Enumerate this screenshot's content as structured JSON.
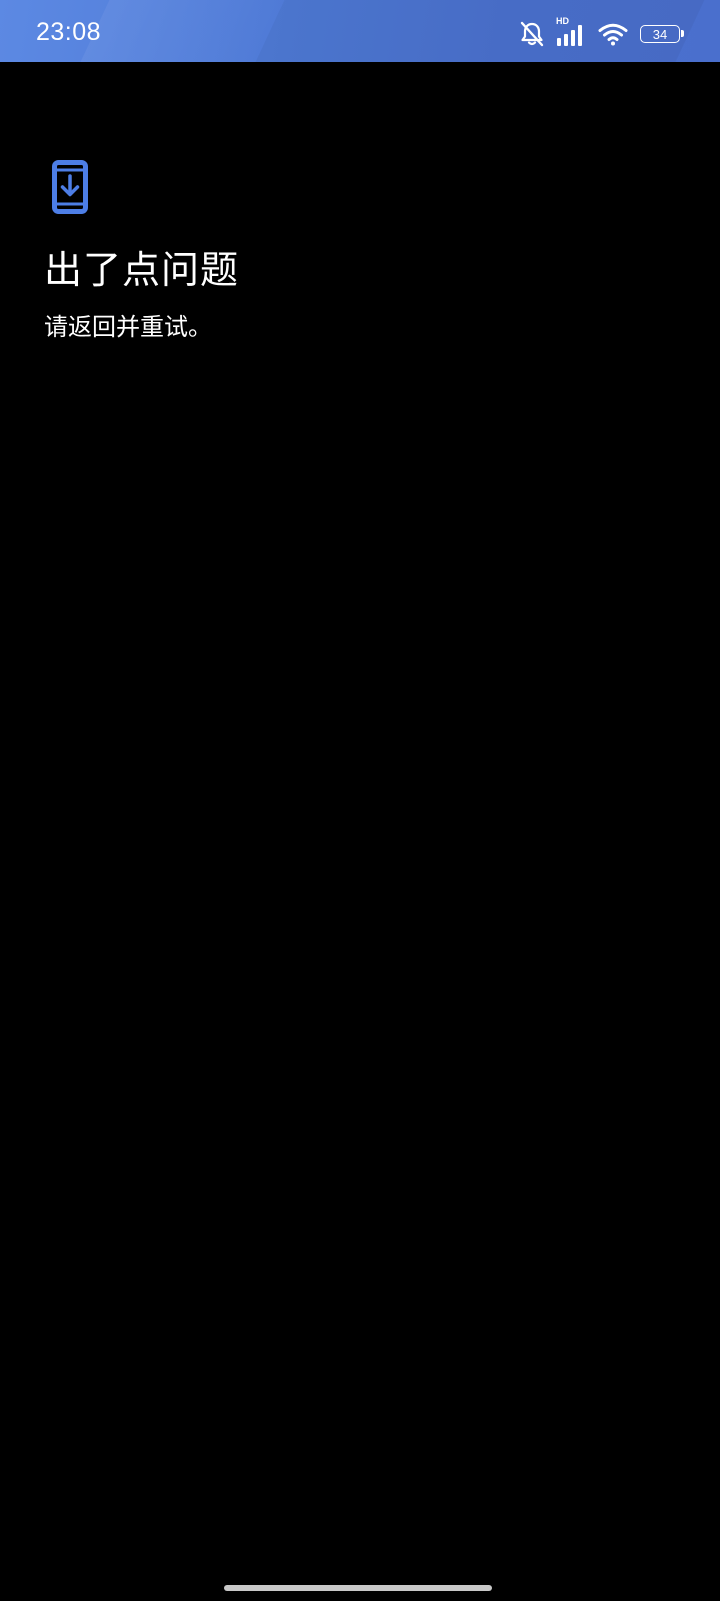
{
  "status_bar": {
    "time": "23:08",
    "battery_level": "34",
    "network_label": "HD",
    "icons": [
      "mute-bell-icon",
      "signal-icon",
      "wifi-icon",
      "battery-icon"
    ],
    "background_color": "#5580d9"
  },
  "error": {
    "icon": "phone-download-icon",
    "icon_color": "#4d7ee6",
    "title": "出了点问题",
    "message": "请返回并重试。"
  },
  "navigation": {
    "home_indicator_color": "#c8c8c8"
  }
}
